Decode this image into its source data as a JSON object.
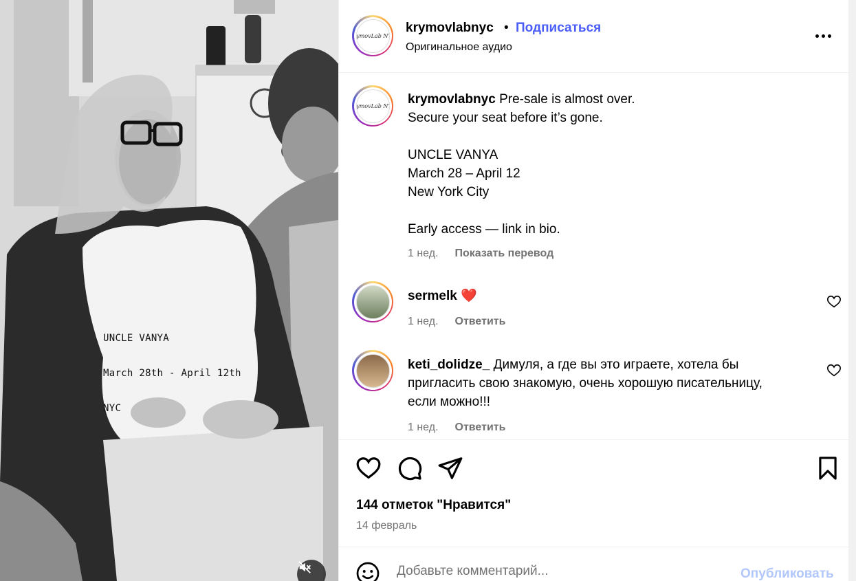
{
  "media": {
    "overlay_lines": [
      "UNCLE VANYA",
      "March 28th - April 12th",
      "NYC"
    ],
    "mute_icon": "speaker-muted-icon"
  },
  "header": {
    "avatar_text": "KrymovLab NYC",
    "username": "krymovlabnyc",
    "separator": "•",
    "follow_label": "Подписаться",
    "audio_label": "Оригинальное аудио",
    "more_icon": "more-horizontal-icon"
  },
  "caption": {
    "username": "krymovlabnyc",
    "lines": [
      "Pre-sale is almost over.",
      "Secure your seat before it’s gone.",
      "",
      "UNCLE VANYA",
      "March 28 – April 12",
      "New York City",
      "",
      "Early access — link in bio."
    ],
    "time": "1 нед.",
    "translate_label": "Показать перевод"
  },
  "comments": [
    {
      "username": "sermelk",
      "text": "❤️",
      "time": "1 нед.",
      "reply_label": "Ответить"
    },
    {
      "username": "keti_dolidze_",
      "text_lines": [
        "Димуля, а где вы это играете, хотела бы",
        "пригласить свою знакомую, очень хорошую писательницу,",
        "если можно!!!"
      ],
      "time": "1 нед.",
      "reply_label": "Ответить"
    }
  ],
  "actions": {
    "like_icon": "heart-icon",
    "comment_icon": "comment-bubble-icon",
    "share_icon": "send-icon",
    "save_icon": "bookmark-icon",
    "likes_text": "144 отметок \"Нравится\"",
    "date": "14 февраль"
  },
  "add_comment": {
    "emoji_icon": "smiley-icon",
    "placeholder": "Добавьте комментарий...",
    "publish_label": "Опубликовать"
  },
  "colors": {
    "link_blue": "#4a5df9",
    "publish_disabled": "#b2c7fb",
    "secondary_text": "#737373",
    "like_heart": "#e8325a"
  }
}
